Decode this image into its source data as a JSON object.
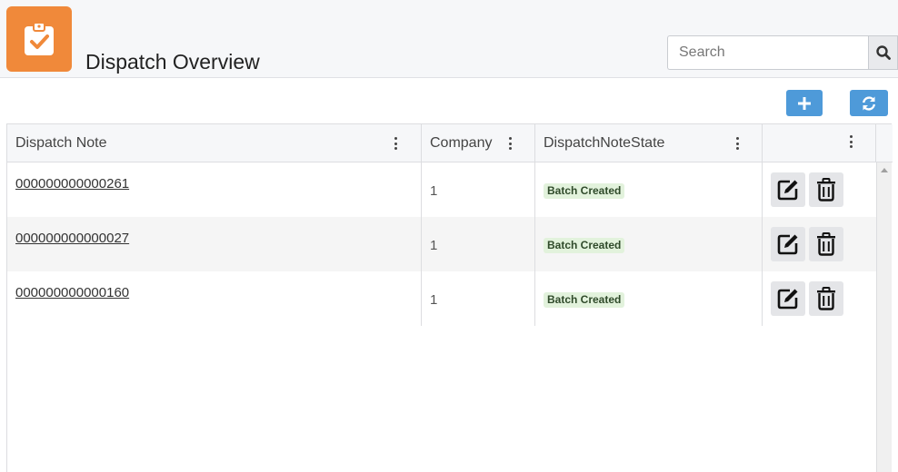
{
  "header": {
    "title": "Dispatch Overview",
    "icon": "clipboard-check-icon",
    "accent_color": "#f0893a"
  },
  "search": {
    "placeholder": "Search",
    "value": ""
  },
  "toolbar": {
    "add_icon": "plus-icon",
    "refresh_icon": "refresh-icon",
    "button_color": "#4e9ad9"
  },
  "table": {
    "columns": [
      "Dispatch Note",
      "Company",
      "DispatchNoteState",
      ""
    ],
    "rows": [
      {
        "dispatch_note": "000000000000261",
        "company": "1",
        "state": "Batch Created"
      },
      {
        "dispatch_note": "000000000000027",
        "company": "1",
        "state": "Batch Created"
      },
      {
        "dispatch_note": "000000000000160",
        "company": "1",
        "state": "Batch Created"
      }
    ],
    "row_actions": [
      "edit-icon",
      "trash-icon"
    ],
    "state_badge_color": "#e2f2dc"
  }
}
